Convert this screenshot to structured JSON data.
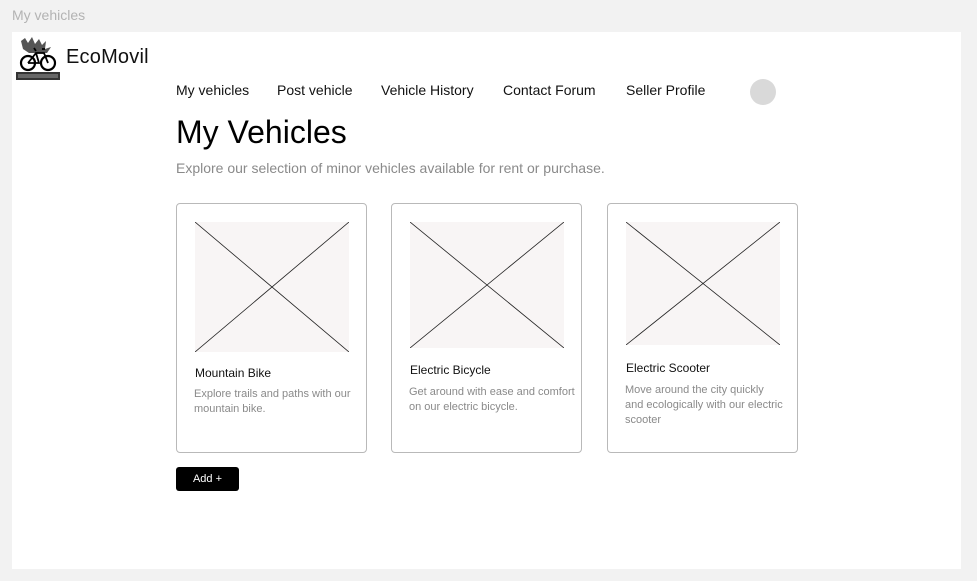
{
  "frame": {
    "title": "My vehicles"
  },
  "brand": {
    "name": "EcoMovil",
    "logo_icon": "bicycle-logo-icon"
  },
  "nav": {
    "items": [
      {
        "label": "My vehicles"
      },
      {
        "label": "Post vehicle"
      },
      {
        "label": "Vehicle History"
      },
      {
        "label": "Contact Forum"
      },
      {
        "label": "Seller Profile"
      }
    ]
  },
  "page": {
    "title": "My Vehicles",
    "subtitle": "Explore our selection of minor vehicles available for rent or purchase."
  },
  "cards": [
    {
      "title": "Mountain Bike",
      "description": "Explore trails and paths with our mountain bike."
    },
    {
      "title": "Electric Bicycle",
      "description": "Get around with ease and comfort on our electric bicycle."
    },
    {
      "title": "Electric Scooter",
      "description": "Move around the city quickly and ecologically with our electric scooter"
    }
  ],
  "actions": {
    "add_label": "Add +"
  },
  "colors": {
    "background": "#f2f2f2",
    "placeholder": "#f8f5f5",
    "button": "#000000"
  }
}
